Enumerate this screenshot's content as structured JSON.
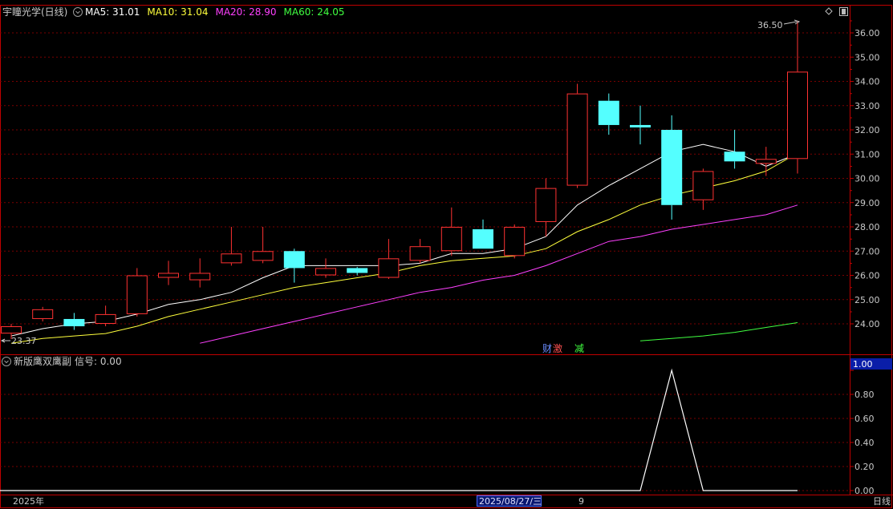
{
  "header": {
    "stock_name": "宇瞳光学(日线)",
    "ma_items": [
      {
        "label": "MA5: 31.01",
        "color": "#ffffff"
      },
      {
        "label": "MA10: 31.04",
        "color": "#ffff3c"
      },
      {
        "label": "MA20: 28.90",
        "color": "#ff40ff"
      },
      {
        "label": "MA60: 24.05",
        "color": "#40ff40"
      }
    ]
  },
  "indicator_header": {
    "name": "新版鹰双鹰副",
    "signal_label": "信号: 0.00"
  },
  "footer": {
    "year": "2025年",
    "cursor_date": "2025/08/27/三",
    "month_mark": "9",
    "period": "日线"
  },
  "colors": {
    "up": "#ff3232",
    "down": "#54ffff",
    "grid": "#7a0000",
    "axis": "#c00000",
    "text": "#c8c8c8",
    "ma5": "#ffffff",
    "ma10": "#ffff3c",
    "ma20": "#ff40ff",
    "ma60": "#40ff40"
  },
  "chart_data": [
    {
      "type": "candlestick",
      "title": "宇瞳光学(日线)",
      "y_ticks": [
        "24.00",
        "25.00",
        "26.00",
        "27.00",
        "28.00",
        "29.00",
        "30.00",
        "31.00",
        "32.00",
        "33.00",
        "34.00",
        "35.00",
        "36.00"
      ],
      "ylim": [
        23.0,
        36.8
      ],
      "high_mark": "36.50",
      "low_mark": "23.37",
      "markers": [
        {
          "text": "财",
          "color": "#6a8cff"
        },
        {
          "text": "激",
          "color": "#ff5050"
        },
        {
          "text": "减",
          "color": "#40ff40"
        }
      ],
      "candles": [
        {
          "o": 23.6,
          "h": 24.0,
          "l": 23.37,
          "c": 23.9
        },
        {
          "o": 24.2,
          "h": 24.7,
          "l": 24.1,
          "c": 24.6
        },
        {
          "o": 24.2,
          "h": 24.45,
          "l": 23.75,
          "c": 23.9
        },
        {
          "o": 24.0,
          "h": 24.75,
          "l": 23.9,
          "c": 24.4
        },
        {
          "o": 24.4,
          "h": 26.3,
          "l": 24.3,
          "c": 26.0
        },
        {
          "o": 25.9,
          "h": 26.6,
          "l": 25.6,
          "c": 26.1
        },
        {
          "o": 25.8,
          "h": 26.7,
          "l": 25.5,
          "c": 26.1
        },
        {
          "o": 26.5,
          "h": 28.0,
          "l": 26.4,
          "c": 26.9
        },
        {
          "o": 26.6,
          "h": 28.0,
          "l": 26.5,
          "c": 27.0
        },
        {
          "o": 27.0,
          "h": 27.1,
          "l": 25.7,
          "c": 26.3
        },
        {
          "o": 26.0,
          "h": 26.7,
          "l": 25.9,
          "c": 26.3
        },
        {
          "o": 26.3,
          "h": 26.35,
          "l": 26.0,
          "c": 26.1
        },
        {
          "o": 25.9,
          "h": 27.5,
          "l": 25.85,
          "c": 26.7
        },
        {
          "o": 26.6,
          "h": 27.5,
          "l": 26.5,
          "c": 27.2
        },
        {
          "o": 27.0,
          "h": 28.8,
          "l": 26.8,
          "c": 28.0
        },
        {
          "o": 27.9,
          "h": 28.3,
          "l": 27.1,
          "c": 27.1
        },
        {
          "o": 26.8,
          "h": 28.1,
          "l": 26.7,
          "c": 28.0
        },
        {
          "o": 28.2,
          "h": 30.0,
          "l": 27.6,
          "c": 29.6
        },
        {
          "o": 29.7,
          "h": 33.9,
          "l": 29.6,
          "c": 33.5
        },
        {
          "o": 33.2,
          "h": 33.5,
          "l": 31.8,
          "c": 32.2
        },
        {
          "o": 32.2,
          "h": 33.0,
          "l": 31.4,
          "c": 32.1
        },
        {
          "o": 32.0,
          "h": 32.6,
          "l": 28.3,
          "c": 28.9
        },
        {
          "o": 29.1,
          "h": 30.4,
          "l": 28.7,
          "c": 30.3
        },
        {
          "o": 31.1,
          "h": 32.0,
          "l": 30.4,
          "c": 30.7
        },
        {
          "o": 30.6,
          "h": 31.3,
          "l": 30.1,
          "c": 30.8
        },
        {
          "o": 30.8,
          "h": 36.5,
          "l": 30.2,
          "c": 34.4
        }
      ],
      "ma5": [
        23.5,
        23.8,
        24.0,
        24.1,
        24.4,
        24.8,
        25.0,
        25.3,
        25.9,
        26.4,
        26.4,
        26.4,
        26.4,
        26.5,
        26.9,
        26.9,
        27.1,
        27.6,
        28.9,
        29.7,
        30.4,
        31.1,
        31.4,
        31.1,
        30.5,
        31.01
      ],
      "ma10": [
        23.2,
        23.4,
        23.5,
        23.6,
        23.9,
        24.3,
        24.6,
        24.9,
        25.2,
        25.5,
        25.7,
        25.9,
        26.1,
        26.4,
        26.6,
        26.7,
        26.8,
        27.1,
        27.8,
        28.3,
        28.9,
        29.3,
        29.6,
        29.9,
        30.3,
        31.04
      ],
      "ma20": [
        null,
        null,
        null,
        null,
        null,
        null,
        23.2,
        23.5,
        23.8,
        24.1,
        24.4,
        24.7,
        25.0,
        25.3,
        25.5,
        25.8,
        26.0,
        26.4,
        26.9,
        27.4,
        27.6,
        27.9,
        28.1,
        28.3,
        28.5,
        28.9
      ],
      "ma60": [
        null,
        null,
        null,
        null,
        null,
        null,
        null,
        null,
        null,
        null,
        null,
        null,
        null,
        null,
        null,
        null,
        null,
        null,
        null,
        null,
        23.3,
        23.4,
        23.5,
        23.65,
        23.85,
        24.05
      ]
    },
    {
      "type": "line",
      "title": "新版鹰双鹰副",
      "y_ticks": [
        "0.00",
        "0.20",
        "0.40",
        "0.60",
        "0.80",
        "1.00"
      ],
      "ylim": [
        0,
        1.0
      ],
      "value_box": "1.00",
      "series": [
        {
          "values": [
            0,
            0,
            0,
            0,
            0,
            0,
            0,
            0,
            0,
            0,
            0,
            0,
            0,
            0,
            0,
            0,
            0,
            0,
            0,
            0,
            0,
            1,
            0,
            0,
            0,
            0
          ]
        }
      ]
    }
  ]
}
